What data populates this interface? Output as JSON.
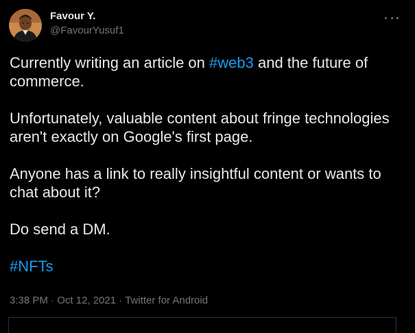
{
  "author": {
    "display_name": "Favour Y.",
    "handle": "@FavourYusuf1"
  },
  "tweet": {
    "p1_before": "Currently writing an article on ",
    "p1_hashtag": "#web3",
    "p1_after": " and the future of commerce.",
    "p2": "Unfortunately, valuable content about fringe technologies aren't exactly on Google's first page.",
    "p3": "Anyone has a link to really insightful content or wants to chat about it?",
    "p4": "Do send a DM.",
    "hashtag_nfts": "#NFTs"
  },
  "meta": {
    "time": "3:38 PM",
    "separator": " · ",
    "date": "Oct 12, 2021",
    "source": "Twitter for Android"
  },
  "icons": {
    "more": "more-options-icon"
  },
  "colors": {
    "background": "#000000",
    "text": "#e7e9ea",
    "secondary": "#71767b",
    "link": "#1d9bf0",
    "border": "#2f3336"
  }
}
